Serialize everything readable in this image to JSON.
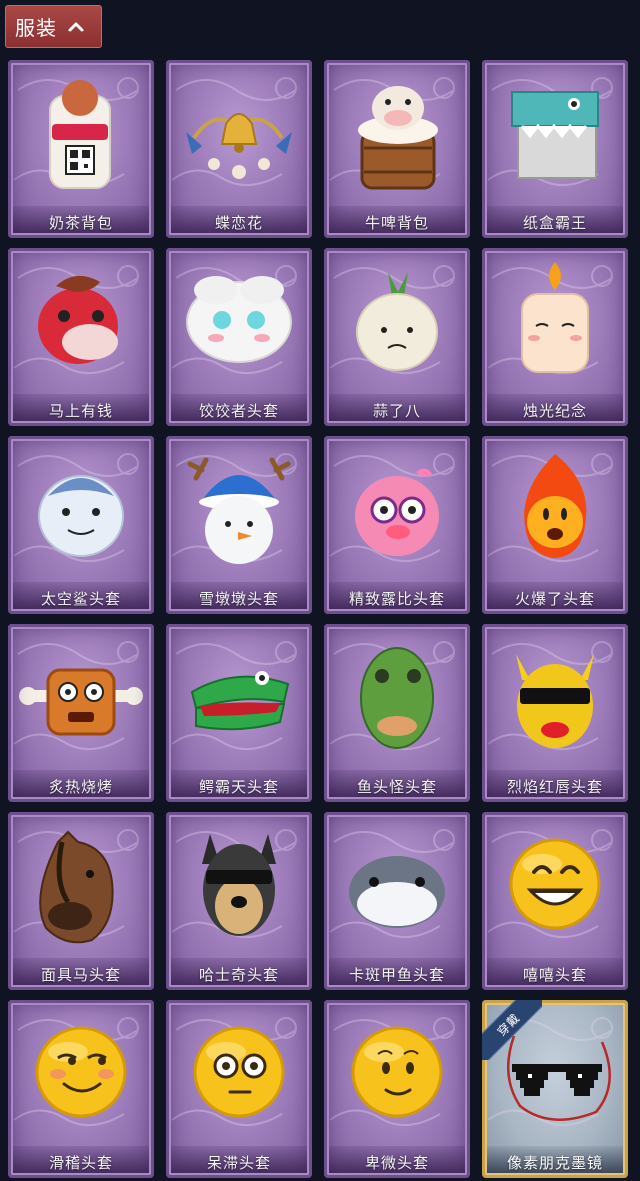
{
  "header": {
    "title": "服装",
    "chevron_icon": "chevron-up-icon"
  },
  "equipped_label": "穿戴",
  "items": [
    {
      "name": "奶茶背包",
      "icon": "milk-tea-backpack"
    },
    {
      "name": "蝶恋花",
      "icon": "butterfly-bell-ornament"
    },
    {
      "name": "牛啤背包",
      "icon": "cow-beer-barrel"
    },
    {
      "name": "纸盒霸王",
      "icon": "cardboard-dinosaur"
    },
    {
      "name": "马上有钱",
      "icon": "red-horse-head"
    },
    {
      "name": "饺饺者头套",
      "icon": "dumpling-head"
    },
    {
      "name": "蒜了八",
      "icon": "garlic-head"
    },
    {
      "name": "烛光纪念",
      "icon": "candle-head"
    },
    {
      "name": "太空鲨头套",
      "icon": "shark-head"
    },
    {
      "name": "雪墩墩头套",
      "icon": "snowman-reindeer-head"
    },
    {
      "name": "精致露比头套",
      "icon": "pink-beaver-head"
    },
    {
      "name": "火爆了头套",
      "icon": "fire-spirit-head"
    },
    {
      "name": "炙热烧烤",
      "icon": "bbq-meat-head"
    },
    {
      "name": "鳄霸天头套",
      "icon": "crocodile-head"
    },
    {
      "name": "鱼头怪头套",
      "icon": "fish-head-mask"
    },
    {
      "name": "烈焰红唇头套",
      "icon": "yellow-lips-sunglasses-head"
    },
    {
      "name": "面具马头套",
      "icon": "horse-mask"
    },
    {
      "name": "哈士奇头套",
      "icon": "husky-sunglasses-head"
    },
    {
      "name": "卡斑甲鱼头套",
      "icon": "gray-fish-head"
    },
    {
      "name": "嘻嘻头套",
      "icon": "grinning-emoji-head"
    },
    {
      "name": "滑稽头套",
      "icon": "funny-emoji-head"
    },
    {
      "name": "呆滞头套",
      "icon": "blank-stare-emoji-head"
    },
    {
      "name": "卑微头套",
      "icon": "humble-emoji-head"
    },
    {
      "name": "像素朋克墨镜",
      "icon": "pixel-sunglasses",
      "equipped": true
    }
  ],
  "colors": {
    "background": "#0f1322",
    "header": "#9b3a3a",
    "card": "#9d7cba",
    "equipped_ribbon": "#2a4470"
  }
}
